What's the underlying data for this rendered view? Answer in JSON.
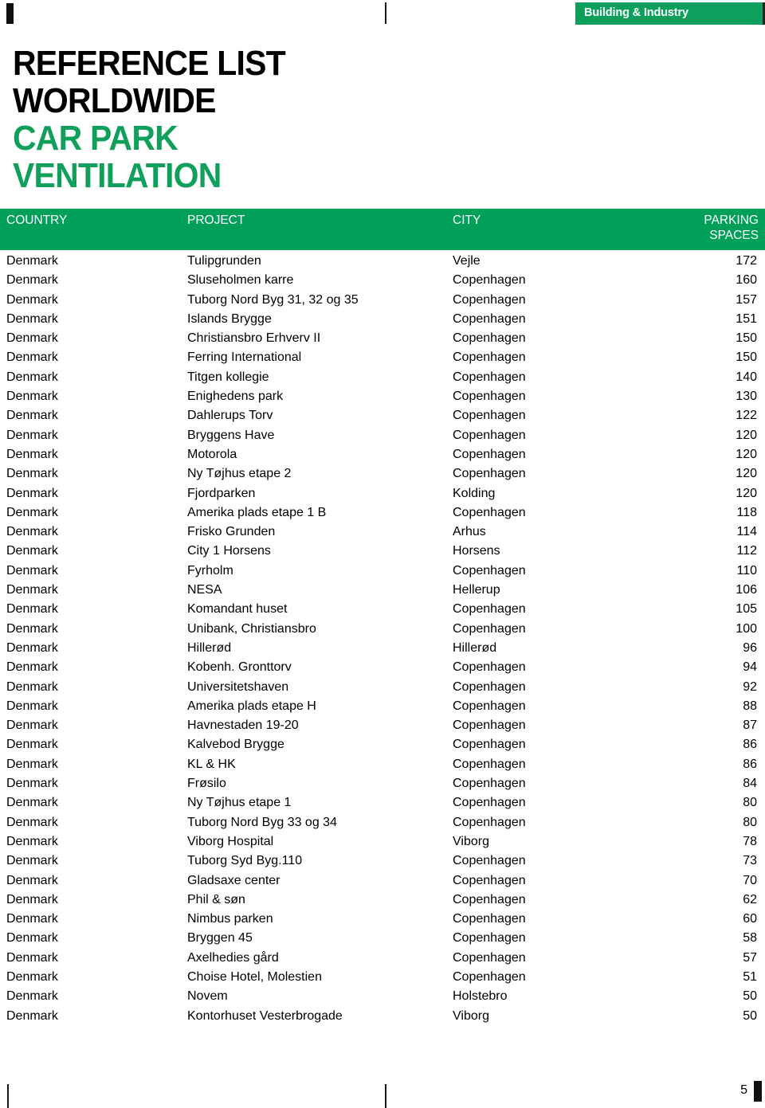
{
  "brand": {
    "banner_label": "Building & Industry",
    "banner_color": "#0CA05B"
  },
  "title": {
    "line1": "REFERENCE LIST",
    "line2": "WORLDWIDE",
    "line3": "CAR PARK",
    "line4": "VENTILATION",
    "dark_color": "#000000",
    "green_color": "#10A05B"
  },
  "table": {
    "header": {
      "country": "COUNTRY",
      "project": "PROJECT",
      "city": "CITY",
      "spaces_line1": "PARKING",
      "spaces_line2": "SPACES",
      "background": "#00A05B"
    },
    "rows": [
      {
        "country": "Denmark",
        "project": "Tulipgrunden",
        "city": "Vejle",
        "spaces": "172"
      },
      {
        "country": "Denmark",
        "project": "Sluseholmen karre",
        "city": "Copenhagen",
        "spaces": "160"
      },
      {
        "country": "Denmark",
        "project": "Tuborg Nord Byg 31, 32 og 35",
        "city": "Copenhagen",
        "spaces": "157"
      },
      {
        "country": "Denmark",
        "project": "Islands Brygge",
        "city": "Copenhagen",
        "spaces": "151"
      },
      {
        "country": "Denmark",
        "project": "Christiansbro Erhverv II",
        "city": "Copenhagen",
        "spaces": "150"
      },
      {
        "country": "Denmark",
        "project": "Ferring International",
        "city": "Copenhagen",
        "spaces": "150"
      },
      {
        "country": "Denmark",
        "project": "Titgen kollegie",
        "city": "Copenhagen",
        "spaces": "140"
      },
      {
        "country": "Denmark",
        "project": "Enighedens park",
        "city": "Copenhagen",
        "spaces": "130"
      },
      {
        "country": "Denmark",
        "project": "Dahlerups Torv",
        "city": "Copenhagen",
        "spaces": "122"
      },
      {
        "country": "Denmark",
        "project": "Bryggens Have",
        "city": "Copenhagen",
        "spaces": "120"
      },
      {
        "country": "Denmark",
        "project": "Motorola",
        "city": "Copenhagen",
        "spaces": "120"
      },
      {
        "country": "Denmark",
        "project": "Ny Tøjhus etape 2",
        "city": "Copenhagen",
        "spaces": "120"
      },
      {
        "country": "Denmark",
        "project": "Fjordparken",
        "city": "Kolding",
        "spaces": "120"
      },
      {
        "country": "Denmark",
        "project": "Amerika plads etape 1 B",
        "city": "Copenhagen",
        "spaces": "118"
      },
      {
        "country": "Denmark",
        "project": "Frisko Grunden",
        "city": "Arhus",
        "spaces": "114"
      },
      {
        "country": "Denmark",
        "project": "City 1 Horsens",
        "city": "Horsens",
        "spaces": "112"
      },
      {
        "country": "Denmark",
        "project": "Fyrholm",
        "city": "Copenhagen",
        "spaces": "110"
      },
      {
        "country": "Denmark",
        "project": "NESA",
        "city": "Hellerup",
        "spaces": "106"
      },
      {
        "country": "Denmark",
        "project": "Komandant huset",
        "city": "Copenhagen",
        "spaces": "105"
      },
      {
        "country": "Denmark",
        "project": "Unibank, Christiansbro",
        "city": "Copenhagen",
        "spaces": "100"
      },
      {
        "country": "Denmark",
        "project": "Hillerød",
        "city": "Hillerød",
        "spaces": "96"
      },
      {
        "country": "Denmark",
        "project": "Kobenh. Gronttorv",
        "city": "Copenhagen",
        "spaces": "94"
      },
      {
        "country": "Denmark",
        "project": "Universitetshaven",
        "city": "Copenhagen",
        "spaces": "92"
      },
      {
        "country": "Denmark",
        "project": "Amerika plads etape H",
        "city": "Copenhagen",
        "spaces": "88"
      },
      {
        "country": "Denmark",
        "project": "Havnestaden 19-20",
        "city": "Copenhagen",
        "spaces": "87"
      },
      {
        "country": "Denmark",
        "project": "Kalvebod Brygge",
        "city": "Copenhagen",
        "spaces": "86"
      },
      {
        "country": "Denmark",
        "project": "KL & HK",
        "city": "Copenhagen",
        "spaces": "86"
      },
      {
        "country": "Denmark",
        "project": "Frøsilo",
        "city": "Copenhagen",
        "spaces": "84"
      },
      {
        "country": "Denmark",
        "project": "Ny Tøjhus etape 1",
        "city": "Copenhagen",
        "spaces": "80"
      },
      {
        "country": "Denmark",
        "project": "Tuborg Nord Byg 33 og 34",
        "city": "Copenhagen",
        "spaces": "80"
      },
      {
        "country": "Denmark",
        "project": "Viborg Hospital",
        "city": "Viborg",
        "spaces": "78"
      },
      {
        "country": "Denmark",
        "project": "Tuborg Syd Byg.110",
        "city": "Copenhagen",
        "spaces": "73"
      },
      {
        "country": "Denmark",
        "project": "Gladsaxe center",
        "city": "Copenhagen",
        "spaces": "70"
      },
      {
        "country": "Denmark",
        "project": "Phil & søn",
        "city": "Copenhagen",
        "spaces": "62"
      },
      {
        "country": "Denmark",
        "project": "Nimbus parken",
        "city": "Copenhagen",
        "spaces": "60"
      },
      {
        "country": "Denmark",
        "project": "Bryggen 45",
        "city": "Copenhagen",
        "spaces": "58"
      },
      {
        "country": "Denmark",
        "project": "Axelhedies gård",
        "city": "Copenhagen",
        "spaces": "57"
      },
      {
        "country": "Denmark",
        "project": "Choise Hotel, Molestien",
        "city": "Copenhagen",
        "spaces": "51"
      },
      {
        "country": "Denmark",
        "project": "Novem",
        "city": "Holstebro",
        "spaces": "50"
      },
      {
        "country": "Denmark",
        "project": "Kontorhuset Vesterbrogade",
        "city": "Viborg",
        "spaces": "50"
      }
    ]
  },
  "footer": {
    "page_number": "5"
  }
}
